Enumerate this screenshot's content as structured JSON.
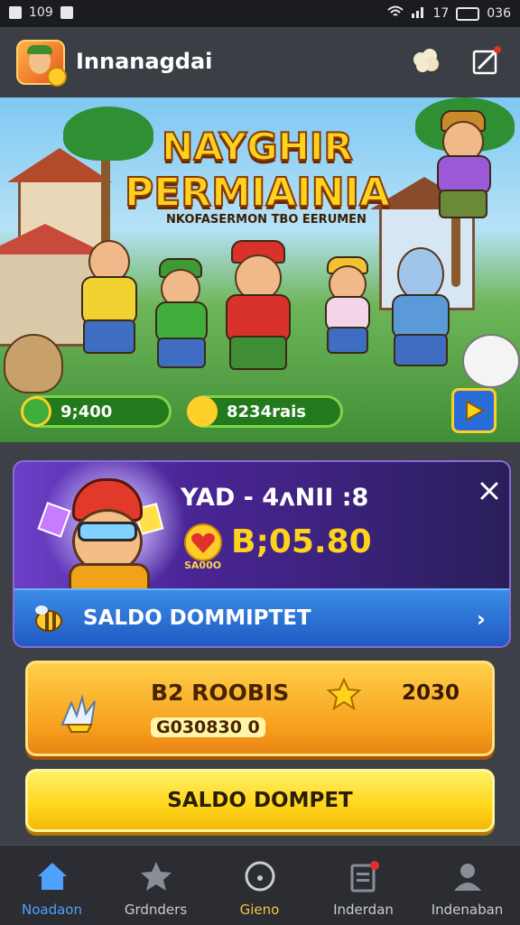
{
  "status_bar": {
    "time": "109",
    "right_text": "17",
    "battery_text": "036"
  },
  "header": {
    "app_name": "Innanagdai"
  },
  "banner": {
    "title_line1": "NAYGHIR",
    "title_line2": "PERMIAINIA",
    "subtitle": "NKOFASERMON TBO EERUMEN",
    "pill_left_value": "9;400",
    "pill_right_value": "8234rais"
  },
  "promo": {
    "title": "YAD - 4ʌNII :8",
    "heart_caption": "SA00O",
    "amount": "B;05.80",
    "wallet_label": "SALDO DOMMIPTET"
  },
  "reward": {
    "title": "B2 ROOBIS",
    "year": "2030",
    "sub": "G030830 0"
  },
  "cta": {
    "label": "SALDO DOMPET"
  },
  "bottom_nav": {
    "items": [
      {
        "label": "Noadaon",
        "icon": "home-icon"
      },
      {
        "label": "Grdnders",
        "icon": "star-icon"
      },
      {
        "label": "Gieno",
        "icon": "game-icon"
      },
      {
        "label": "Inderdan",
        "icon": "inbox-icon"
      },
      {
        "label": "Indenaban",
        "icon": "profile-icon"
      }
    ]
  },
  "colors": {
    "accent_blue": "#4ea1ff",
    "gold": "#ffd21e",
    "promo_purple": "#4a2596"
  }
}
